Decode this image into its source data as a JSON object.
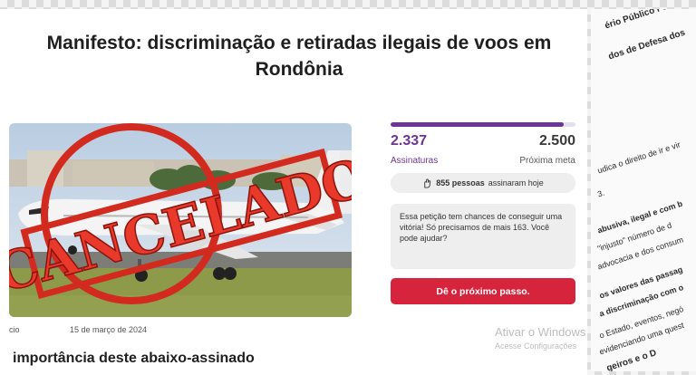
{
  "petition": {
    "title": "Manifesto: discriminação e retiradas ilegais de voos em Rondônia",
    "category_fragment": "cio",
    "date": "15 de março de 2024",
    "section_heading": "importância deste abaixo-assinado",
    "image_stamp": "CANCELADO"
  },
  "stats": {
    "signatures": "2.337",
    "goal": "2.500",
    "progress_fraction": 0.935,
    "signatures_label": "Assinaturas",
    "goal_label": "Próxima meta",
    "today_count": "855 pessoas",
    "today_text": "assinaram hoje",
    "victory_message": "Essa petição tem chances de conseguir uma vitória! Só precisamos de mais 163. Você pode ajudar?",
    "cta_label": "Dê o próximo passo."
  },
  "watermark": {
    "line1": "Ativar o Windows",
    "line2": "Acesse Configurações"
  },
  "clippings": [
    "ério Público Federal,",
    "dos de Defesa dos",
    "udica o direito de ir e vir",
    "3.",
    "abusiva, ilegal e com b",
    "\"injusto\" número de d",
    "advocacia e dos consum",
    "os valores das passag",
    "a discriminação com o",
    "o Estado, eventos, negó",
    "evidenciando uma quest",
    "geiros e o D"
  ],
  "colors": {
    "brand_purple": "#6c3596",
    "cta_red": "#d6243d",
    "stamp_red": "#d22a1f"
  }
}
